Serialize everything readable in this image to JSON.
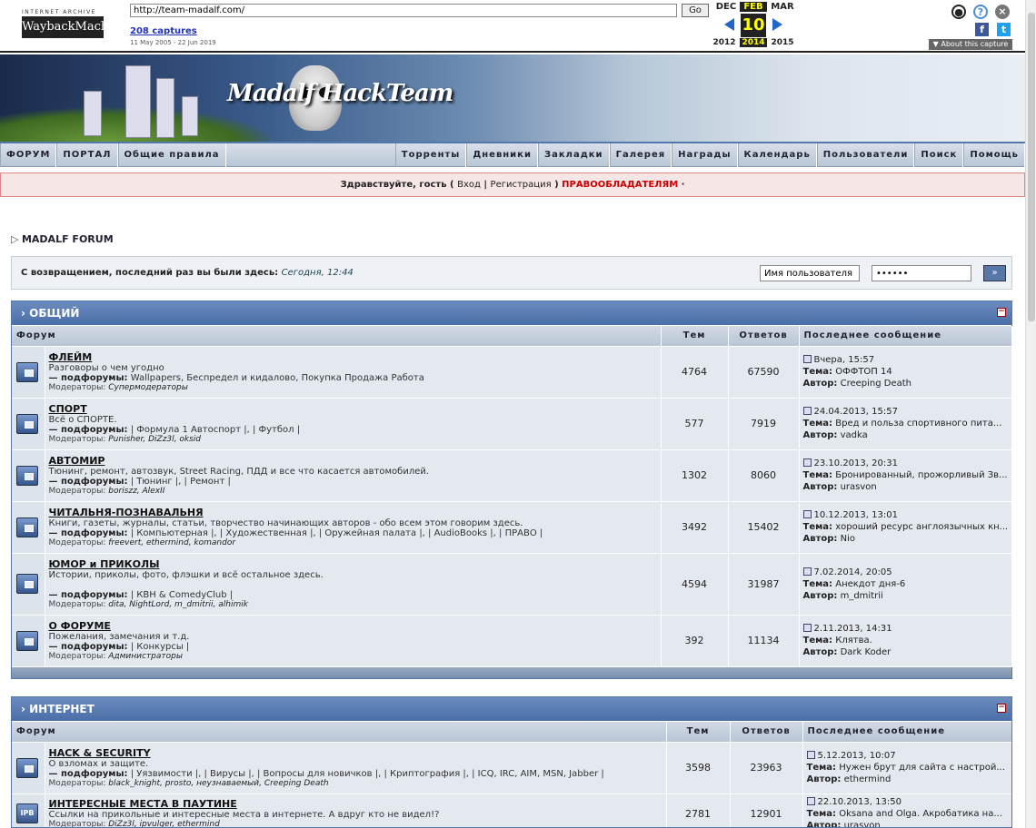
{
  "wayback": {
    "ia_text": "INTERNET ARCHIVE",
    "logo": "WaybackMachine",
    "url": "http://team-madalf.com/",
    "go": "Go",
    "captures": "208 captures",
    "range": "11 May 2005 - 22 Jun 2019",
    "prev_month": "DEC",
    "cur_month": "FEB",
    "next_month": "MAR",
    "day": "10",
    "prev_year": "2012",
    "cur_year": "2014",
    "next_year": "2015",
    "about": "▼ About this capture"
  },
  "banner": {
    "title": "Madalf  HackTeam"
  },
  "nav": {
    "left": [
      "ФОРУМ",
      "ПОРТАЛ",
      "Общие правила"
    ],
    "right": [
      "Торренты",
      "Дневники",
      "Закладки",
      "Галерея",
      "Награды",
      "Календарь",
      "Пользователи",
      "Поиск",
      "Помощь"
    ]
  },
  "guest": {
    "greeting": "Здравствуйте, гость",
    "open": "(",
    "login": "Вход",
    "sep": "|",
    "register": "Регистрация",
    "close": ")",
    "rights": "ПРАВООБЛАДАТЕЛЯМ",
    "dot": "·"
  },
  "breadcrumb": "MADALF FORUM",
  "welcome": {
    "text": "С возвращением, последний раз вы были здесь:",
    "time": "Сегодня, 12:44",
    "username": "Имя пользователя",
    "password": "••••••",
    "button": "»"
  },
  "columns": {
    "forum": "Форум",
    "topics": "Тем",
    "replies": "Ответов",
    "last": "Последнее сообщение"
  },
  "labels": {
    "subforums": "— подфорумы:",
    "moderators": "Модераторы:",
    "topic": "Тема:",
    "author": "Автор:"
  },
  "categories": [
    {
      "title": "ОБЩИЙ",
      "forums": [
        {
          "name": "ФЛЕЙМ",
          "desc": "Разговоры о чем угодно",
          "subs": "Wallpapers, Беспредел и кидалово, Покупка Продажа Работа",
          "mods": "Супермодераторы",
          "topics": "4764",
          "replies": "67590",
          "date": "Вчера, 15:57",
          "topic": "ОФФТОП 14",
          "author": "Creeping Death"
        },
        {
          "name": "СПОРТ",
          "desc": "Всё о СПОРТЕ.",
          "subs": "| Формула 1 Автоспорт |, | Футбол |",
          "mods": "Punisher, DiZz3l, oksid",
          "topics": "577",
          "replies": "7919",
          "date": "24.04.2013, 15:57",
          "topic": "Вред и польза спортивного пита...",
          "author": "vadka"
        },
        {
          "name": "АВТОМИР",
          "desc": "Тюнинг, ремонт, автозвук, Street Racing, ПДД и все что касается автомобилей.",
          "subs": "| Тюнинг |, | Ремонт |",
          "mods": "boriszz, AlexII",
          "topics": "1302",
          "replies": "8060",
          "date": "23.10.2013, 20:31",
          "topic": "Бронированный, прожорливый Зв...",
          "author": "urasvon"
        },
        {
          "name": "ЧИТАЛЬНЯ-ПОЗНАВАЛЬНЯ",
          "desc": "Книги, газеты, журналы, статьи, творчество начинающих авторов - обо всем этом говорим здесь.",
          "subs": "| Компьютерная |, | Художественная |, | Оружейная палата |, | AudioBooks |, | ПРАВО |",
          "mods": "freevert, ethermind, komandor",
          "topics": "3492",
          "replies": "15402",
          "date": "10.12.2013, 13:01",
          "topic": "хороший ресурс англоязычных кн...",
          "author": "Nio"
        },
        {
          "name": "ЮМОР и ПРИКОЛЫ",
          "desc": "Истории, приколы, фото, флэшки и всё остальное здесь.",
          "subs": "| КВН & ComedyClub |",
          "mods": "dita, NightLord, m_dmitrii, alhimik",
          "topics": "4594",
          "replies": "31987",
          "date": "7.02.2014, 20:05",
          "topic": "Анекдот дня-6",
          "author": "m_dmitrii"
        },
        {
          "name": "О ФОРУМЕ",
          "desc": "Пожелания, замечания и т.д.",
          "subs": "| Конкурсы |",
          "mods": "Администраторы",
          "topics": "392",
          "replies": "11134",
          "date": "2.11.2013, 14:31",
          "topic": "Клятва.",
          "author": "Dark Koder"
        }
      ]
    },
    {
      "title": "ИНТЕРНЕТ",
      "forums": [
        {
          "name": "HACK & SECURITY",
          "desc": "О взломах и защите.",
          "subs": "| Уязвимости |, | Вирусы |, | Вопросы для новичков |, | Криптография |, | ICQ, IRC, AIM, MSN, Jabber |",
          "mods": "black_knight, prosto, неузнаваемый, Creeping Death",
          "topics": "3598",
          "replies": "23963",
          "date": "5.12.2013, 10:07",
          "topic": "Нужен брут для сайта с настрой...",
          "author": "ethermind"
        },
        {
          "name": "ИНТЕРЕСНЫЕ МЕСТА В ПАУТИНЕ",
          "desc": "Ссылки на прикольные и интересные места в интернете. А вдруг кто не видел!?",
          "subs": "",
          "mods": "DiZz3l, ipvulger, ethermind",
          "topics": "2781",
          "replies": "12901",
          "date": "22.10.2013, 13:50",
          "topic": "Oksana and Olga. Акробатика на...",
          "author": "urasvon",
          "icon": "IPB"
        }
      ]
    }
  ]
}
